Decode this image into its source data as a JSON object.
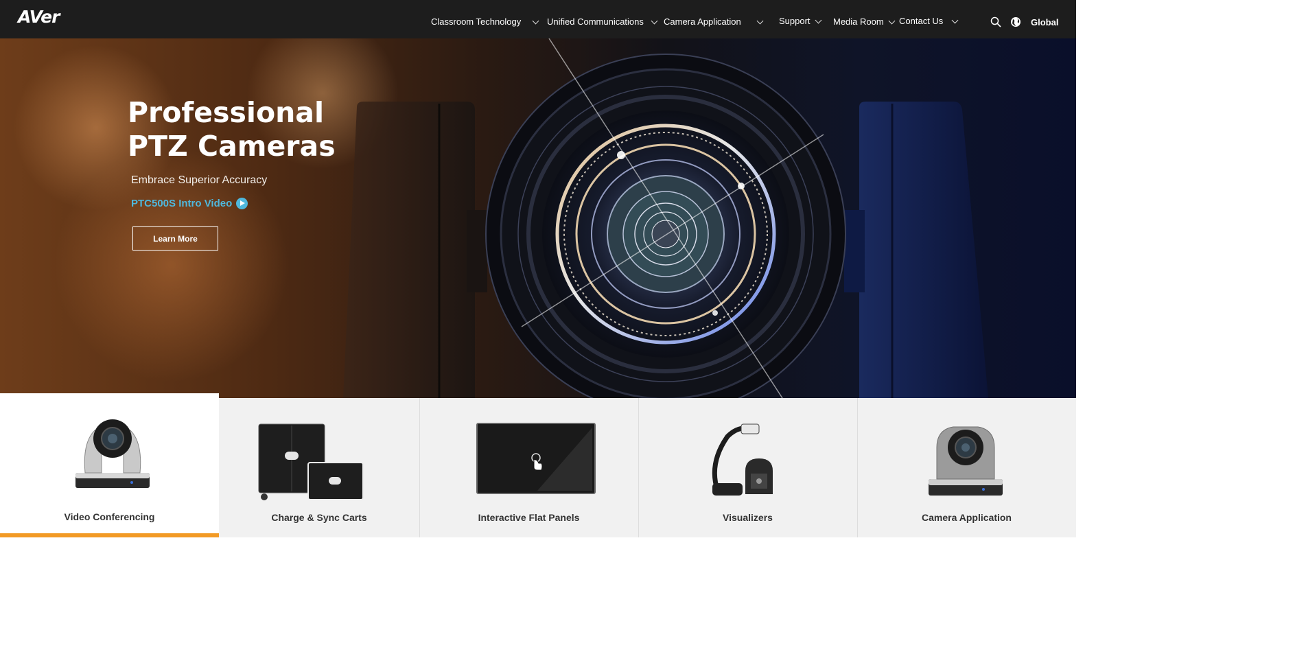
{
  "brand": {
    "logo_text": "AVer"
  },
  "nav": {
    "items": [
      {
        "label": "Classroom Technology"
      },
      {
        "label": "Unified Communications"
      },
      {
        "label": "Camera Application"
      },
      {
        "label": "Support"
      },
      {
        "label": "Media Room"
      },
      {
        "label": "Contact Us"
      }
    ],
    "search_icon": "search-icon",
    "globe_icon": "globe-icon",
    "region_label": "Global"
  },
  "hero": {
    "title_line1": "Professional",
    "title_line2": "PTZ Cameras",
    "subtitle": "Embrace Superior Accuracy",
    "video_link": "PTC500S Intro Video",
    "cta_label": "Learn More"
  },
  "categories": [
    {
      "label": "Video Conferencing",
      "icon": "ptz-camera-icon",
      "active": true
    },
    {
      "label": "Charge & Sync Carts",
      "icon": "charging-cart-icon",
      "active": false
    },
    {
      "label": "Interactive Flat Panels",
      "icon": "flat-panel-icon",
      "active": false
    },
    {
      "label": "Visualizers",
      "icon": "document-camera-icon",
      "active": false
    },
    {
      "label": "Camera Application",
      "icon": "ptz-camera-icon",
      "active": false
    }
  ],
  "colors": {
    "header_bg": "#1d1d1d",
    "link_blue": "#4fb8dd",
    "accent_orange": "#f29a25",
    "strip_bg": "#f1f1f1"
  }
}
